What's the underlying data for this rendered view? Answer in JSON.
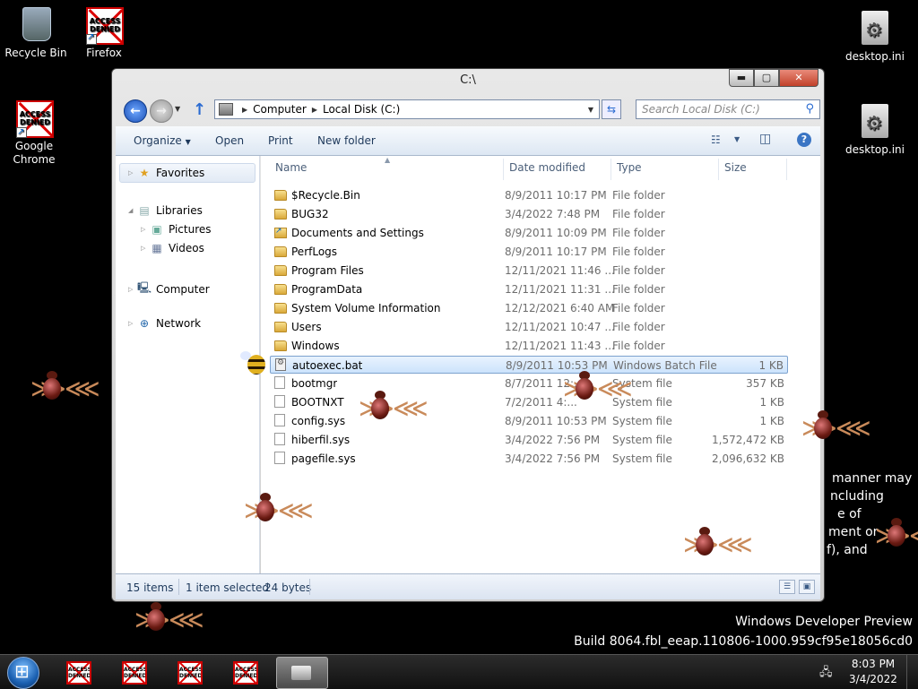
{
  "desktop": {
    "icons": [
      {
        "label": "Recycle Bin"
      },
      {
        "label": "Firefox",
        "overlay": "ACCESS DENIED"
      },
      {
        "label": "Google Chrome",
        "overlay": "ACCESS DENIED"
      },
      {
        "label": "desktop.ini"
      },
      {
        "label": "desktop.ini"
      }
    ],
    "background_text": [
      "manner may",
      "ncluding",
      "e of",
      "ment or",
      "f), and"
    ],
    "watermark": {
      "line1": "Windows Developer Preview",
      "line2": "Build 8064.fbl_eeap.110806-1000.959cf95e18056cd0"
    }
  },
  "window": {
    "title": "C:\\",
    "controls": {
      "minimize": "▬",
      "maximize": "▢",
      "close": "✕"
    },
    "address": {
      "crumbs": [
        "Computer",
        "Local Disk (C:)"
      ]
    },
    "search": {
      "placeholder": "Search Local Disk (C:)"
    },
    "toolbar": {
      "organize": "Organize",
      "open": "Open",
      "print": "Print",
      "new_folder": "New folder"
    },
    "nav": {
      "favorites": "Favorites",
      "libraries": "Libraries",
      "pictures": "Pictures",
      "videos": "Videos",
      "computer": "Computer",
      "network": "Network"
    },
    "columns": {
      "name": "Name",
      "date": "Date modified",
      "type": "Type",
      "size": "Size"
    },
    "files": [
      {
        "name": "$Recycle.Bin",
        "date": "8/9/2011 10:17 PM",
        "type": "File folder",
        "size": "",
        "icon": "folder"
      },
      {
        "name": "BUG32",
        "date": "3/4/2022 7:48 PM",
        "type": "File folder",
        "size": "",
        "icon": "folder"
      },
      {
        "name": "Documents and Settings",
        "date": "8/9/2011 10:09 PM",
        "type": "File folder",
        "size": "",
        "icon": "junction"
      },
      {
        "name": "PerfLogs",
        "date": "8/9/2011 10:17 PM",
        "type": "File folder",
        "size": "",
        "icon": "folder"
      },
      {
        "name": "Program Files",
        "date": "12/11/2021 11:46 ...",
        "type": "File folder",
        "size": "",
        "icon": "folder"
      },
      {
        "name": "ProgramData",
        "date": "12/11/2021 11:31 ...",
        "type": "File folder",
        "size": "",
        "icon": "folder"
      },
      {
        "name": "System Volume Information",
        "date": "12/12/2021 6:40 AM",
        "type": "File folder",
        "size": "",
        "icon": "folder"
      },
      {
        "name": "Users",
        "date": "12/11/2021 10:47 ...",
        "type": "File folder",
        "size": "",
        "icon": "folder"
      },
      {
        "name": "Windows",
        "date": "12/11/2021 11:43 ...",
        "type": "File folder",
        "size": "",
        "icon": "folder"
      },
      {
        "name": "autoexec.bat",
        "date": "8/9/2011 10:53 PM",
        "type": "Windows Batch File",
        "size": "1 KB",
        "icon": "bat",
        "selected": true
      },
      {
        "name": "bootmgr",
        "date": "8/7/2011 12:...",
        "type": "System file",
        "size": "357 KB",
        "icon": "doc"
      },
      {
        "name": "BOOTNXT",
        "date": "7/2/2011 4:...",
        "type": "System file",
        "size": "1 KB",
        "icon": "doc"
      },
      {
        "name": "config.sys",
        "date": "8/9/2011 10:53 PM",
        "type": "System file",
        "size": "1 KB",
        "icon": "doc"
      },
      {
        "name": "hiberfil.sys",
        "date": "3/4/2022 7:56 PM",
        "type": "System file",
        "size": "1,572,472 KB",
        "icon": "doc"
      },
      {
        "name": "pagefile.sys",
        "date": "3/4/2022 7:56 PM",
        "type": "System file",
        "size": "2,096,632 KB",
        "icon": "doc"
      }
    ],
    "status": {
      "items": "15 items",
      "selected": "1 item selected",
      "bytes": "24 bytes"
    }
  },
  "taskbar": {
    "app_overlay": "ACCESS DENIED",
    "clock": {
      "time": "8:03 PM",
      "date": "3/4/2022"
    }
  }
}
